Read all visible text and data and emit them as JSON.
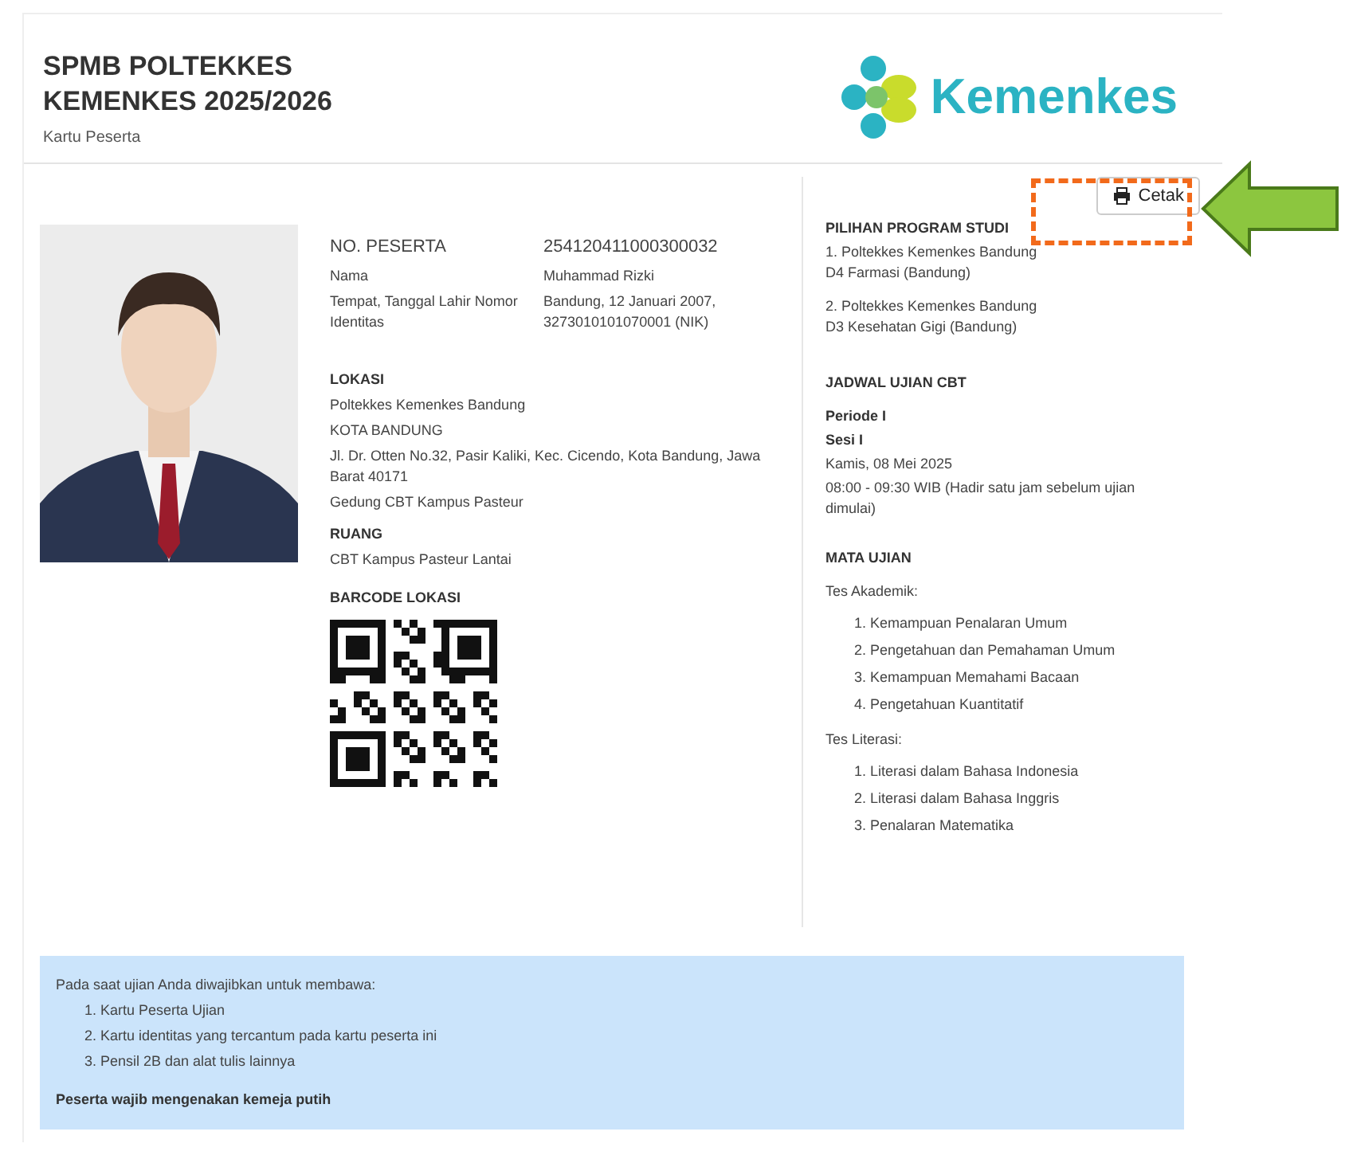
{
  "header": {
    "title_lines": [
      "SPMB POLTEKKES",
      "KEMENKES 2025/2026"
    ],
    "subtitle": "Kartu Peserta",
    "logo_text": "Kemenkes"
  },
  "print_button": {
    "label": "Cetak",
    "highlighted": true
  },
  "participant": [
    {
      "label": "NO. PESERTA",
      "value": "254120411000300032"
    },
    {
      "label": "Nama",
      "value": "Muhammad Rizki"
    },
    {
      "label": "Tempat, Tanggal Lahir Nomor Identitas",
      "value": "Bandung, 12 Januari 2007, 3273010101070001 (NIK)"
    }
  ],
  "location": {
    "heading": "LOKASI",
    "lines": [
      "Poltekkes Kemenkes Bandung",
      "KOTA BANDUNG",
      "Jl. Dr. Otten No.32, Pasir Kaliki, Kec. Cicendo, Kota Bandung, Jawa Barat 40171",
      "Gedung CBT Kampus Pasteur"
    ]
  },
  "room": {
    "heading": "RUANG",
    "value": "CBT Kampus Pasteur Lantai"
  },
  "qr": {
    "heading": "BARCODE LOKASI"
  },
  "programs": {
    "heading": "PILIHAN PROGRAM STUDI",
    "items": [
      {
        "institution": "1. Poltekkes Kemenkes Bandung",
        "program": "D4 Farmasi (Bandung)"
      },
      {
        "institution": "2. Poltekkes Kemenkes Bandung",
        "program": "D3 Kesehatan Gigi (Bandung)"
      }
    ]
  },
  "schedule": {
    "heading": "JADWAL UJIAN CBT",
    "period": "Periode I",
    "session": "Sesi I",
    "date": "Kamis, 08 Mei 2025",
    "time": "08:00 - 09:30 WIB (Hadir satu jam sebelum ujian dimulai)"
  },
  "subjects": {
    "heading": "MATA UJIAN",
    "groups": [
      {
        "title": "Tes Akademik:",
        "items": [
          "1. Kemampuan Penalaran Umum",
          "2. Pengetahuan dan Pemahaman Umum",
          "3. Kemampuan Memahami Bacaan",
          "4. Pengetahuan Kuantitatif"
        ]
      },
      {
        "title": "Tes Literasi:",
        "items": [
          "1. Literasi dalam Bahasa Indonesia",
          "2. Literasi dalam Bahasa Inggris",
          "3. Penalaran Matematika"
        ]
      }
    ]
  },
  "notice": {
    "intro": "Pada saat ujian Anda diwajibkan untuk membawa:",
    "items": [
      "1. Kartu Peserta Ujian",
      "2. Kartu identitas yang tercantum pada kartu peserta ini",
      "3. Pensil 2B dan alat tulis lainnya"
    ],
    "footer": "Peserta wajib mengenakan kemeja putih"
  }
}
